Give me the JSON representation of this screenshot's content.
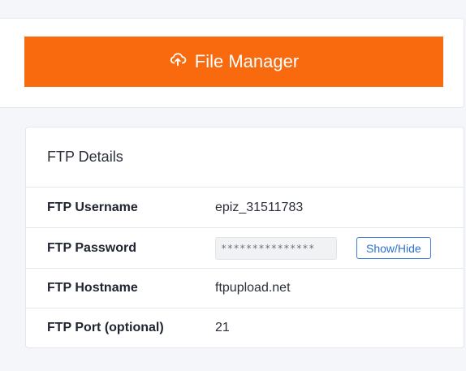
{
  "file_manager": {
    "label": "File Manager",
    "icon": "cloud-upload-icon",
    "color": "#f86a0d"
  },
  "ftp_details": {
    "title": "FTP Details",
    "username": {
      "label": "FTP Username",
      "value": "epiz_31511783"
    },
    "password": {
      "label": "FTP Password",
      "masked_value": "***************",
      "toggle_label": "Show/Hide"
    },
    "hostname": {
      "label": "FTP Hostname",
      "value": "ftpupload.net"
    },
    "port": {
      "label": "FTP Port (optional)",
      "value": "21"
    }
  }
}
